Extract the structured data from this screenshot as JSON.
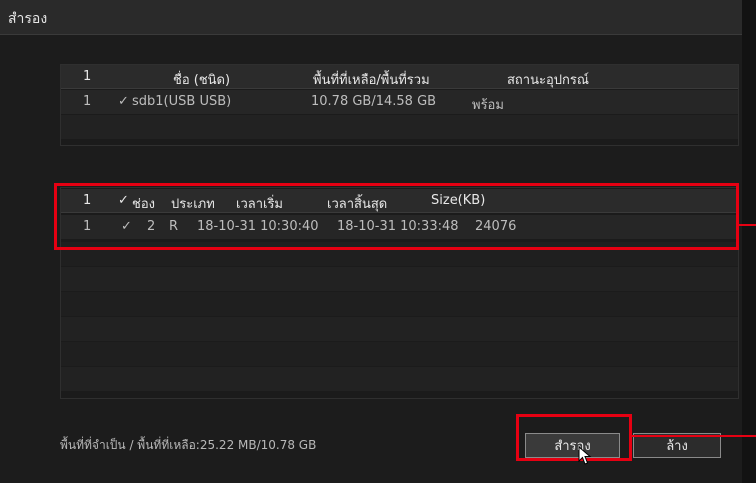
{
  "window": {
    "title": "สำรอง"
  },
  "devices": {
    "headers": [
      "1",
      "ชื่อ (ชนิด)",
      "พื้นที่ที่เหลือ/พื้นที่รวม",
      "สถานะอุปกรณ์"
    ],
    "rows": [
      {
        "no": "1",
        "check": "✓",
        "name": "sdb1(USB USB)",
        "space": "10.78 GB/14.58 GB",
        "status": "พร้อม"
      }
    ]
  },
  "files": {
    "headers": {
      "no": "1",
      "check": "✓",
      "channel": "ช่อง",
      "type": "ประเภท",
      "start": "เวลาเริ่ม",
      "end": "เวลาสิ้นสุด",
      "size": "Size(KB)"
    },
    "rows": [
      {
        "no": "1",
        "check": "✓",
        "channel": "2",
        "type": "R",
        "start": "18-10-31 10:30:40",
        "end": "18-10-31 10:33:48",
        "size": "24076"
      }
    ]
  },
  "footer": {
    "space_info": "พื้นที่ที่จำเป็น / พื้นที่ที่เหลือ:25.22 MB/10.78 GB",
    "backup_label": "สำรอง",
    "clear_label": "ล้าง"
  },
  "colors": {
    "highlight": "#e60012",
    "background": "#1c1c1c"
  }
}
